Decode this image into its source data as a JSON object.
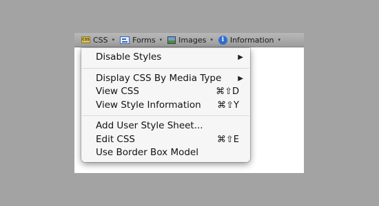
{
  "toolbar": {
    "css": {
      "icon": "css-icon",
      "label": "CSS",
      "arrow": "▾"
    },
    "forms": {
      "icon": "forms-icon",
      "label": "Forms",
      "arrow": "▾"
    },
    "images": {
      "icon": "images-icon",
      "label": "Images",
      "arrow": "▾"
    },
    "information": {
      "icon": "info-icon",
      "label": "Information",
      "arrow": "▾",
      "icon_glyph": "i"
    }
  },
  "css_icon_text": "CSS",
  "menu": {
    "disable_styles": {
      "label": "Disable Styles",
      "submenu": "▶"
    },
    "display_by_media": {
      "label": "Display CSS By Media Type",
      "submenu": "▶"
    },
    "view_css": {
      "label": "View CSS",
      "shortcut": "⌘⇧D"
    },
    "view_style_info": {
      "label": "View Style Information",
      "shortcut": "⌘⇧Y"
    },
    "add_user_style": {
      "label": "Add User Style Sheet..."
    },
    "edit_css": {
      "label": "Edit CSS",
      "shortcut": "⌘⇧E"
    },
    "border_box": {
      "label": "Use Border Box Model"
    }
  },
  "colors": {
    "background": "#a3a3a3",
    "toolbar": "#ababab",
    "menu": "#f6f6f6",
    "info_icon": "#2f6fd0"
  }
}
